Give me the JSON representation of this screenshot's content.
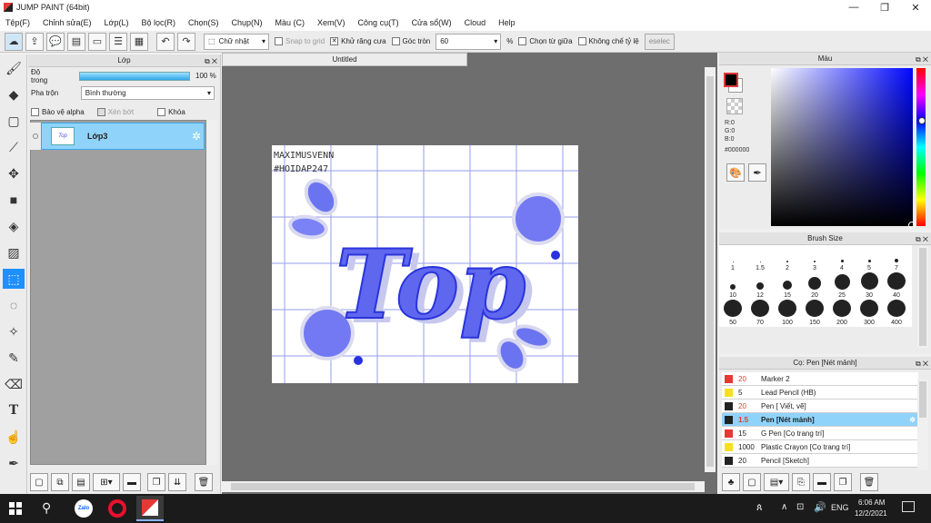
{
  "app": {
    "title": "JUMP PAINT (64bit)"
  },
  "menu": [
    "Tệp(F)",
    "Chỉnh sửa(E)",
    "Lớp(L)",
    "Bộ lọc(R)",
    "Chọn(S)",
    "Chụp(N)",
    "Màu (C)",
    "Xem(V)",
    "Công cụ(T)",
    "Cửa sổ(W)",
    "Cloud",
    "Help"
  ],
  "toolbar": {
    "shape_select": "Chữ nhật",
    "snap": "Snap to grid",
    "antialias": "Khử răng cưa",
    "round_corner": "Góc tròn",
    "corner_value": "60",
    "percent": "%",
    "select_center": "Chọn từ giữa",
    "no_ratio": "Không chế tỷ lệ",
    "deselect": "eselec"
  },
  "layer_panel": {
    "title": "Lớp",
    "opacity_label": "Độ trong",
    "opacity_value": "100 %",
    "opacity": 1.0,
    "blend_label": "Pha trộn",
    "blend_value": "Bình thường",
    "protect_alpha": "Bảo vệ alpha",
    "clip": "Xén bớt",
    "lock": "Khóa",
    "layer_name": "Lớp3"
  },
  "document": {
    "tab": "Untitled"
  },
  "artwork": {
    "watermark1": "MAXIMUSVENN",
    "watermark2": "#HOIDAP247",
    "word": "Top"
  },
  "color_panel": {
    "title": "Màu",
    "r": "R:0",
    "g": "G:0",
    "b": "B:0",
    "hex": "#000000"
  },
  "brush_panel": {
    "title": "Brush Size",
    "sizes": [
      "1",
      "1.5",
      "2",
      "3",
      "4",
      "5",
      "7",
      "10",
      "12",
      "15",
      "20",
      "25",
      "30",
      "40",
      "50",
      "70",
      "100",
      "150",
      "200",
      "300",
      "400"
    ]
  },
  "pen_panel": {
    "title": "Cọ: Pen [Nét mảnh]",
    "items": [
      {
        "size": "20",
        "name": "Marker 2",
        "color": "#e53935",
        "size_color": "#e53935"
      },
      {
        "size": "5",
        "name": "Lead Pencil (HB)",
        "color": "#f5e11b",
        "size_color": "#222"
      },
      {
        "size": "20",
        "name": "Pen [ Viết, vẽ]",
        "color": "#222222",
        "size_color": "#e53935"
      },
      {
        "size": "1.5",
        "name": "Pen [Nét mảnh]",
        "color": "#222222",
        "size_color": "#e53935",
        "active": true
      },
      {
        "size": "15",
        "name": "G Pen [Cọ trang trí]",
        "color": "#e53935",
        "size_color": "#222"
      },
      {
        "size": "1000",
        "name": "Plastic Crayon [Cọ trang trí]",
        "color": "#f5e11b",
        "size_color": "#222"
      },
      {
        "size": "20",
        "name": "Pencil [Sketch]",
        "color": "#222222",
        "size_color": "#222"
      }
    ]
  },
  "taskbar": {
    "time": "6:06 AM",
    "date": "12/2/2021",
    "lang": "ENG"
  }
}
